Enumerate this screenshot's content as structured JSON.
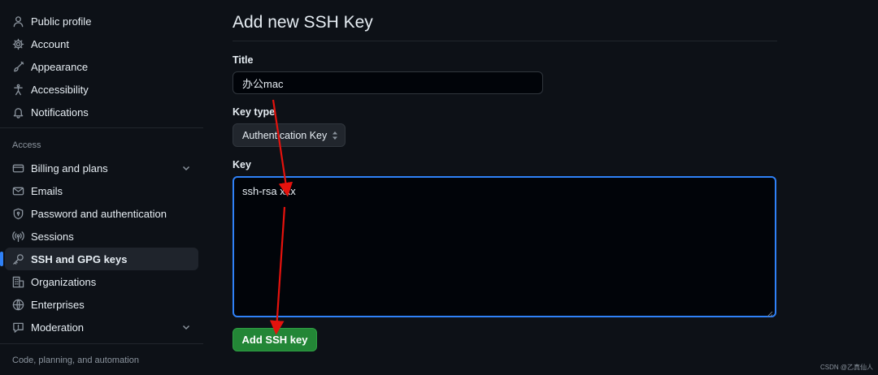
{
  "sidebar": {
    "items": [
      {
        "label": "Public profile",
        "icon": "person-icon"
      },
      {
        "label": "Account",
        "icon": "gear-icon"
      },
      {
        "label": "Appearance",
        "icon": "paintbrush-icon"
      },
      {
        "label": "Accessibility",
        "icon": "accessibility-icon"
      },
      {
        "label": "Notifications",
        "icon": "bell-icon"
      }
    ],
    "access_heading": "Access",
    "access_items": [
      {
        "label": "Billing and plans",
        "icon": "credit-card-icon",
        "expandable": true
      },
      {
        "label": "Emails",
        "icon": "mail-icon"
      },
      {
        "label": "Password and authentication",
        "icon": "shield-lock-icon"
      },
      {
        "label": "Sessions",
        "icon": "broadcast-icon"
      },
      {
        "label": "SSH and GPG keys",
        "icon": "key-icon",
        "active": true
      },
      {
        "label": "Organizations",
        "icon": "organization-icon"
      },
      {
        "label": "Enterprises",
        "icon": "globe-icon"
      },
      {
        "label": "Moderation",
        "icon": "report-icon",
        "expandable": true
      }
    ],
    "code_heading": "Code, planning, and automation"
  },
  "main": {
    "page_title": "Add new SSH Key",
    "title_label": "Title",
    "title_value": "办公mac",
    "key_type_label": "Key type",
    "key_type_value": "Authentication Key",
    "key_label": "Key",
    "key_value": "ssh-rsa xxx",
    "submit_label": "Add SSH key"
  },
  "colors": {
    "background": "#0d1117",
    "accent_blue": "#2f81f7",
    "button_green": "#238636",
    "annotation_red": "#e5120d"
  },
  "watermark": "CSDN @乙真仙人"
}
